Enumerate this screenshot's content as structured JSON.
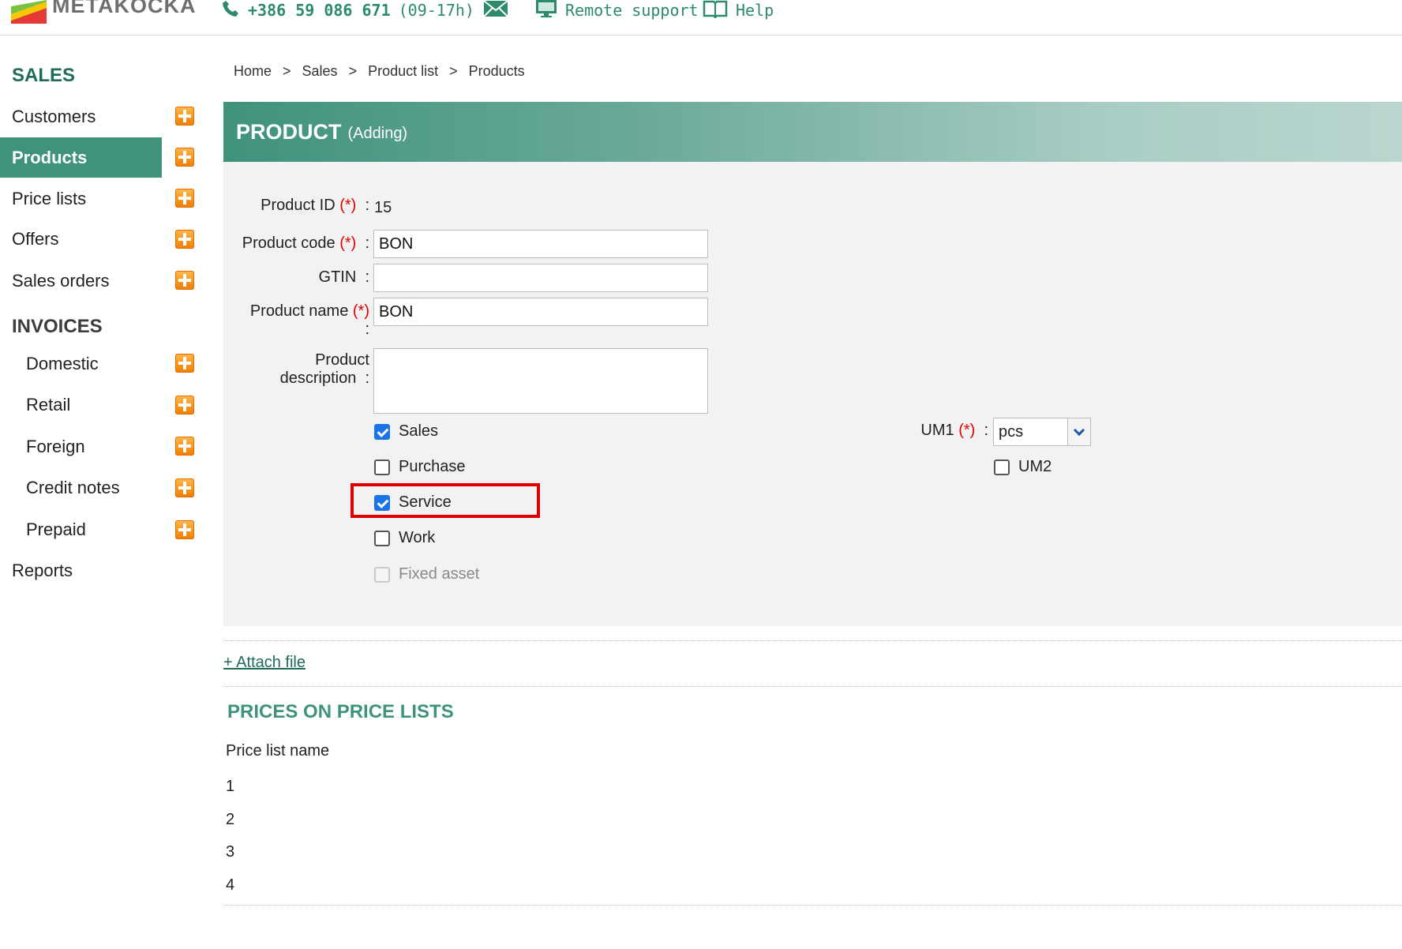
{
  "header": {
    "brand": "METAKOCKA",
    "phone": "+386 59 086 671",
    "hours": "(09-17h)",
    "remote_support": "Remote support",
    "help": "Help"
  },
  "sidebar": {
    "sales_title": "SALES",
    "sales_items": [
      {
        "label": "Customers"
      },
      {
        "label": "Products"
      },
      {
        "label": "Price lists"
      },
      {
        "label": "Offers"
      },
      {
        "label": "Sales orders"
      }
    ],
    "invoices_title": "INVOICES",
    "invoice_items": [
      {
        "label": "Domestic"
      },
      {
        "label": "Retail"
      },
      {
        "label": "Foreign"
      },
      {
        "label": "Credit notes"
      },
      {
        "label": "Prepaid"
      }
    ],
    "reports": "Reports"
  },
  "breadcrumb": [
    "Home",
    ">",
    "Sales",
    ">",
    "Product list",
    ">",
    "Products"
  ],
  "panel": {
    "title": "PRODUCT",
    "subtitle": "(Adding)"
  },
  "form": {
    "product_id_label": "Product ID",
    "product_id_value": "15",
    "product_code_label": "Product code",
    "product_code_value": "BON",
    "gtin_label": "GTIN",
    "gtin_value": "",
    "product_name_label": "Product name",
    "product_name_value": "BON",
    "product_description_label_1": "Product",
    "product_description_label_2": "description",
    "product_description_value": "",
    "required_mark": "(*)",
    "colon": ":",
    "checkboxes": [
      {
        "label": "Sales",
        "checked": true,
        "disabled": false
      },
      {
        "label": "Purchase",
        "checked": false,
        "disabled": false
      },
      {
        "label": "Service",
        "checked": true,
        "disabled": false
      },
      {
        "label": "Work",
        "checked": false,
        "disabled": false
      },
      {
        "label": "Fixed asset",
        "checked": false,
        "disabled": true
      }
    ],
    "um1_label": "UM1",
    "um1_value": "pcs",
    "um2_label": "UM2",
    "um2_checked": false
  },
  "attach_file": "+ Attach file",
  "prices": {
    "title": "PRICES ON PRICE LISTS",
    "column": "Price list name",
    "rows": [
      "1",
      "2",
      "3",
      "4"
    ]
  }
}
